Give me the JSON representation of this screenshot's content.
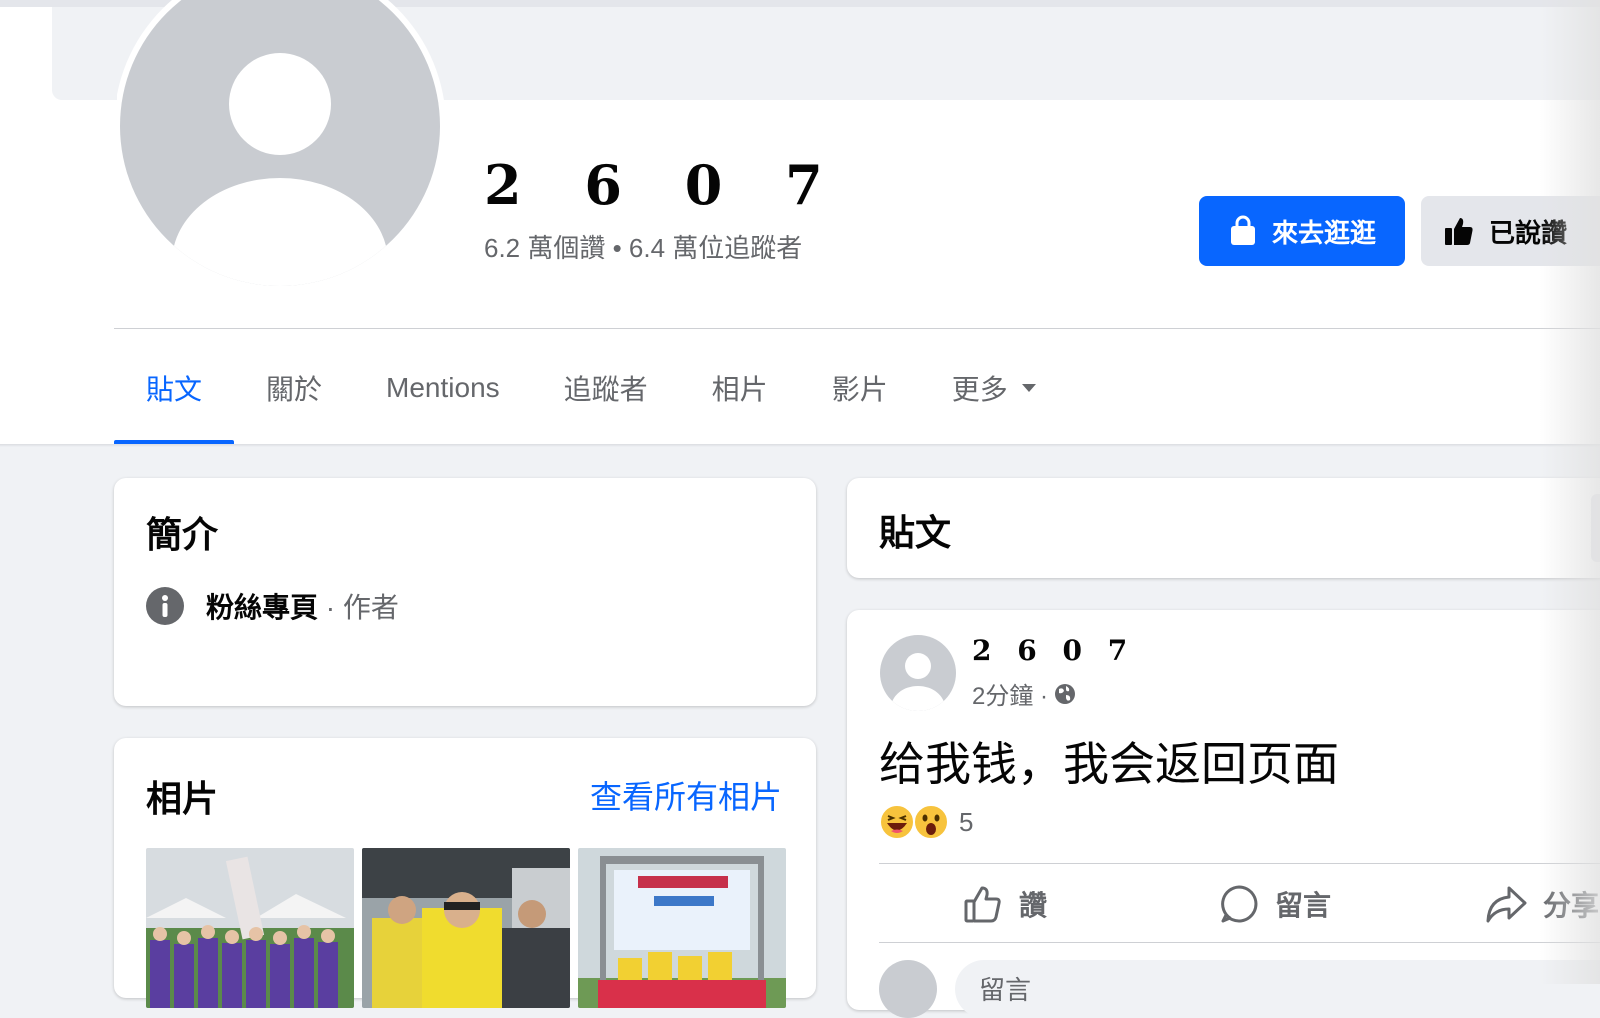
{
  "profile": {
    "name": "2 6 0 7",
    "stats": "6.2 萬個讚 • 6.4 萬位追蹤者",
    "shop_button": "來去逛逛",
    "liked_button": "已說讚"
  },
  "tabs": [
    {
      "label": "貼文",
      "active": true
    },
    {
      "label": "關於"
    },
    {
      "label": "Mentions"
    },
    {
      "label": "追蹤者"
    },
    {
      "label": "相片"
    },
    {
      "label": "影片"
    },
    {
      "label": "更多"
    }
  ],
  "intro": {
    "title": "簡介",
    "category": "粉絲專頁",
    "separator": "·",
    "subcategory": "作者"
  },
  "photos": {
    "title": "相片",
    "see_all": "查看所有相片"
  },
  "posts_header": {
    "title": "貼文"
  },
  "post": {
    "author": "2 6 0 7",
    "time": "2分鐘 ·",
    "text": "给我钱，我会返回页面",
    "reaction_count": "5",
    "actions": {
      "like": "讚",
      "comment": "留言",
      "share": "分享"
    },
    "comment_placeholder": "留言"
  },
  "colors": {
    "accent": "#0866ff",
    "secondary_text": "#65676b",
    "background": "#f0f2f5"
  },
  "icons": [
    "shopping-bag-icon",
    "thumbs-up-icon",
    "caret-down-icon",
    "info-icon",
    "globe-icon",
    "laugh-reaction-icon",
    "wow-reaction-icon",
    "comment-icon",
    "share-icon"
  ]
}
